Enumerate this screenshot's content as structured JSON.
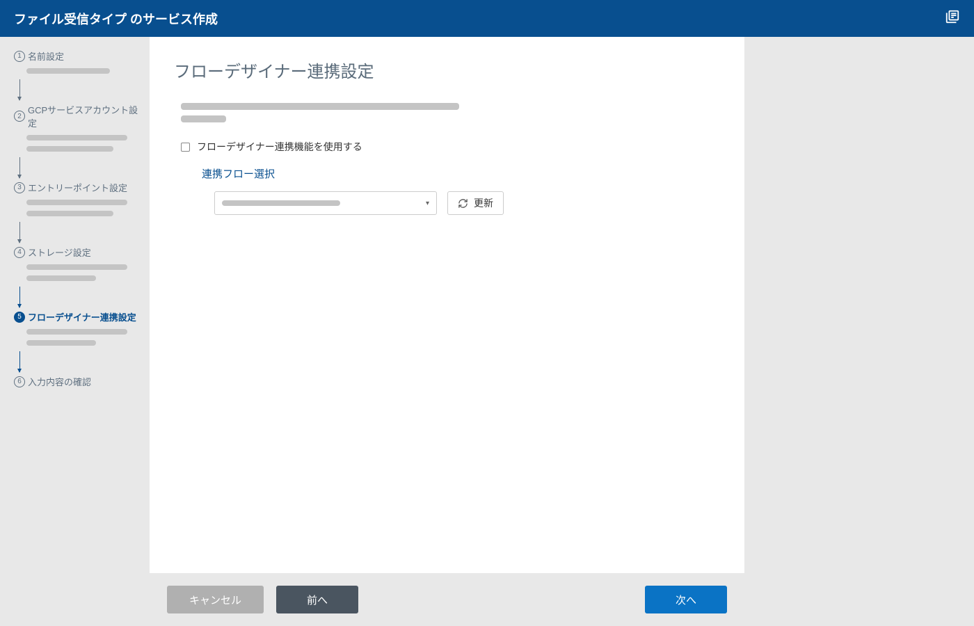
{
  "header": {
    "title": "ファイル受信タイプ のサービス作成"
  },
  "sidebar": {
    "steps": [
      {
        "num": "1",
        "label": "名前設定"
      },
      {
        "num": "2",
        "label": "GCPサービスアカウント設定"
      },
      {
        "num": "3",
        "label": "エントリーポイント設定"
      },
      {
        "num": "4",
        "label": "ストレージ設定"
      },
      {
        "num": "5",
        "label": "フローデザイナー連携設定"
      },
      {
        "num": "6",
        "label": "入力内容の確認"
      }
    ]
  },
  "content": {
    "title": "フローデザイナー連携設定",
    "checkbox_label": "フローデザイナー連携機能を使用する",
    "sub_title": "連携フロー選択",
    "refresh_label": "更新"
  },
  "footer": {
    "cancel": "キャンセル",
    "prev": "前へ",
    "next": "次へ"
  }
}
